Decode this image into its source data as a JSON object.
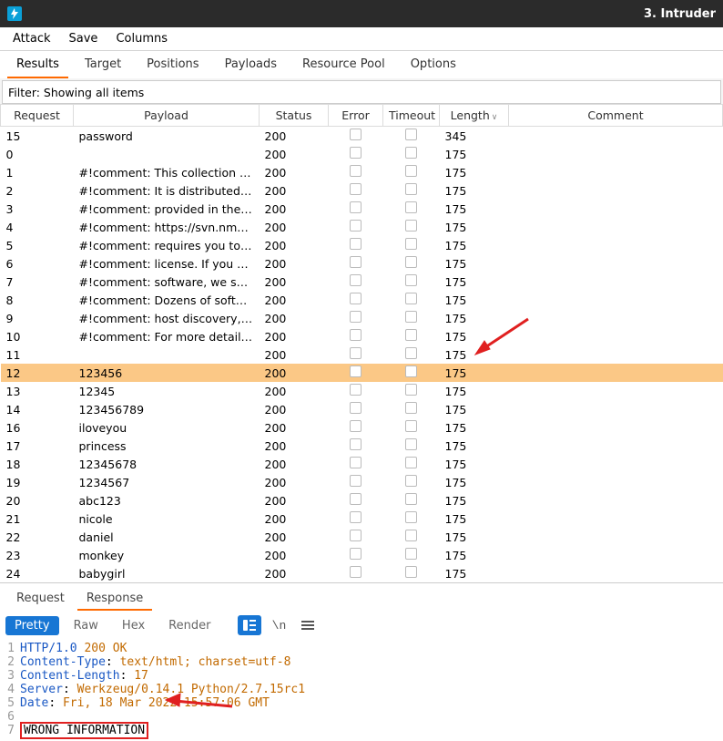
{
  "window": {
    "title": "3. Intruder"
  },
  "menubar": {
    "items": [
      "Attack",
      "Save",
      "Columns"
    ]
  },
  "main_tabs": {
    "items": [
      "Results",
      "Target",
      "Positions",
      "Payloads",
      "Resource Pool",
      "Options"
    ],
    "active_index": 0
  },
  "filter": {
    "text": "Filter: Showing all items"
  },
  "results_table": {
    "columns": [
      "Request",
      "Payload",
      "Status",
      "Error",
      "Timeout",
      "Length",
      "Comment"
    ],
    "sorted_column": "Length",
    "rows": [
      {
        "request": "15",
        "payload": "password",
        "status": "200",
        "length": "345"
      },
      {
        "request": "0",
        "payload": "",
        "status": "200",
        "length": "175"
      },
      {
        "request": "1",
        "payload": "#!comment: This collection of d...",
        "status": "200",
        "length": "175"
      },
      {
        "request": "2",
        "payload": "#!comment: It is distributed und...",
        "status": "200",
        "length": "175"
      },
      {
        "request": "3",
        "payload": "#!comment: provided in the LIC...",
        "status": "200",
        "length": "175"
      },
      {
        "request": "4",
        "payload": "#!comment: https://svn.nmap.or...",
        "status": "200",
        "length": "175"
      },
      {
        "request": "5",
        "payload": "#!comment: requires you to lice...",
        "status": "200",
        "length": "175"
      },
      {
        "request": "6",
        "payload": "#!comment: license.  If you wish ...",
        "status": "200",
        "length": "175"
      },
      {
        "request": "7",
        "payload": "#!comment: software, we sell al...",
        "status": "200",
        "length": "175"
      },
      {
        "request": "8",
        "payload": "#!comment: Dozens of software...",
        "status": "200",
        "length": "175"
      },
      {
        "request": "9",
        "payload": "#!comment: host discovery, port...",
        "status": "200",
        "length": "175"
      },
      {
        "request": "10",
        "payload": "#!comment: For more details, s...",
        "status": "200",
        "length": "175"
      },
      {
        "request": "11",
        "payload": "",
        "status": "200",
        "length": "175"
      },
      {
        "request": "12",
        "payload": "123456",
        "status": "200",
        "length": "175",
        "selected": true
      },
      {
        "request": "13",
        "payload": "12345",
        "status": "200",
        "length": "175"
      },
      {
        "request": "14",
        "payload": "123456789",
        "status": "200",
        "length": "175"
      },
      {
        "request": "16",
        "payload": "iloveyou",
        "status": "200",
        "length": "175"
      },
      {
        "request": "17",
        "payload": "princess",
        "status": "200",
        "length": "175"
      },
      {
        "request": "18",
        "payload": "12345678",
        "status": "200",
        "length": "175"
      },
      {
        "request": "19",
        "payload": "1234567",
        "status": "200",
        "length": "175"
      },
      {
        "request": "20",
        "payload": "abc123",
        "status": "200",
        "length": "175"
      },
      {
        "request": "21",
        "payload": "nicole",
        "status": "200",
        "length": "175"
      },
      {
        "request": "22",
        "payload": "daniel",
        "status": "200",
        "length": "175"
      },
      {
        "request": "23",
        "payload": "monkey",
        "status": "200",
        "length": "175"
      },
      {
        "request": "24",
        "payload": "babygirl",
        "status": "200",
        "length": "175"
      }
    ]
  },
  "detail": {
    "tabs": [
      "Request",
      "Response"
    ],
    "active_index": 1,
    "view_modes": [
      "Pretty",
      "Raw",
      "Hex",
      "Render"
    ],
    "active_mode_index": 0,
    "response_lines": [
      "HTTP/1.0 200 OK",
      "Content-Type: text/html; charset=utf-8",
      "Content-Length: 17",
      "Server: Werkzeug/0.14.1 Python/2.7.15rc1",
      "Date: Fri, 18 Mar 2022 15:57:06 GMT",
      "",
      "WRONG INFORMATION"
    ]
  }
}
